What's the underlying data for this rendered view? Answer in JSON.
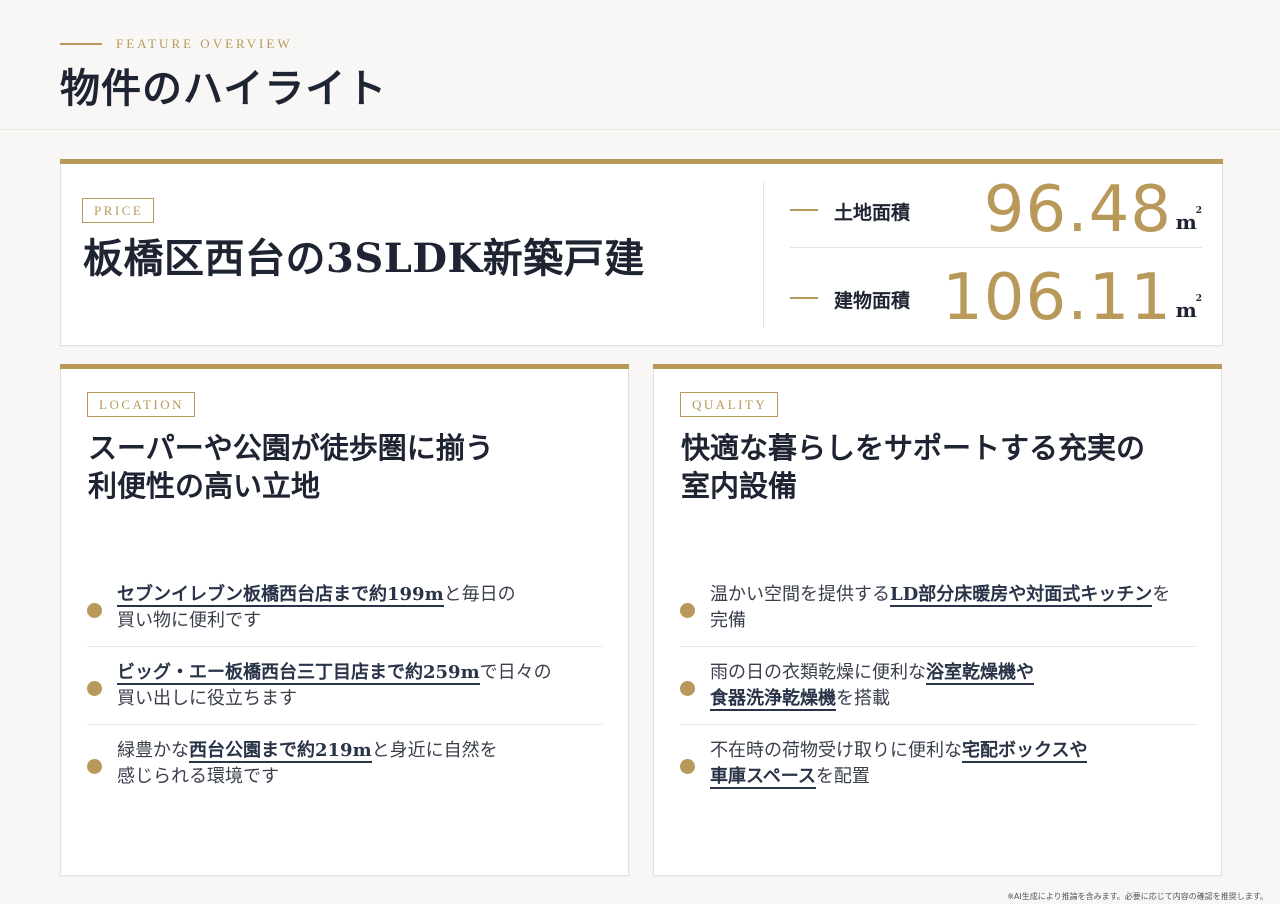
{
  "header": {
    "eyebrow": "FEATURE OVERVIEW",
    "title": "物件のハイライト"
  },
  "price": {
    "tag": "PRICE",
    "title": "板橋区西台の3SLDK新築戸建",
    "areas": [
      {
        "label": "土地面積",
        "value": "96.48",
        "unit": "m",
        "unit_sup": "2"
      },
      {
        "label": "建物面積",
        "value": "106.11",
        "unit": "m",
        "unit_sup": "2"
      }
    ]
  },
  "location": {
    "tag": "LOCATION",
    "heading": [
      "スーパーや公園が徒歩圏に揃う",
      "利便性の高い立地"
    ],
    "items": [
      {
        "l1_hl": "セブンイレブン板橋西台店まで約199m",
        "l1_rest": "と毎日の",
        "l2": "買い物に便利です"
      },
      {
        "l1_hl": "ビッグ・エー板橋西台三丁目店まで約259m",
        "l1_rest": "で日々の",
        "l2": "買い出しに役立ちます"
      },
      {
        "l1_pre": "緑豊かな",
        "l1_hl": "西台公園まで約219m",
        "l1_rest": "と身近に自然を",
        "l2": "感じられる環境です"
      }
    ]
  },
  "quality": {
    "tag": "QUALITY",
    "heading": [
      "快適な暮らしをサポートする充実の",
      "室内設備"
    ],
    "items": [
      {
        "l1_pre": "温かい空間を提供する",
        "l1_hl": "LD部分床暖房や対面式キッチン",
        "l1_rest": "を",
        "l2": "完備"
      },
      {
        "l1_pre": "雨の日の衣類乾燥に便利な",
        "l1_hl": "浴室乾燥機や",
        "l2_hl": "食器洗浄乾燥機",
        "l2_rest": "を搭載"
      },
      {
        "l1_pre": "不在時の荷物受け取りに便利な",
        "l1_hl": "宅配ボックスや",
        "l2_hl": "車庫スペース",
        "l2_rest": "を配置"
      }
    ]
  },
  "footnote": "※AI生成により推論を含みます。必要に応じて内容の確認を推奨します。",
  "colors": {
    "accent": "#b8995a",
    "text": "#1f2433",
    "background": "#f8f7f5"
  }
}
